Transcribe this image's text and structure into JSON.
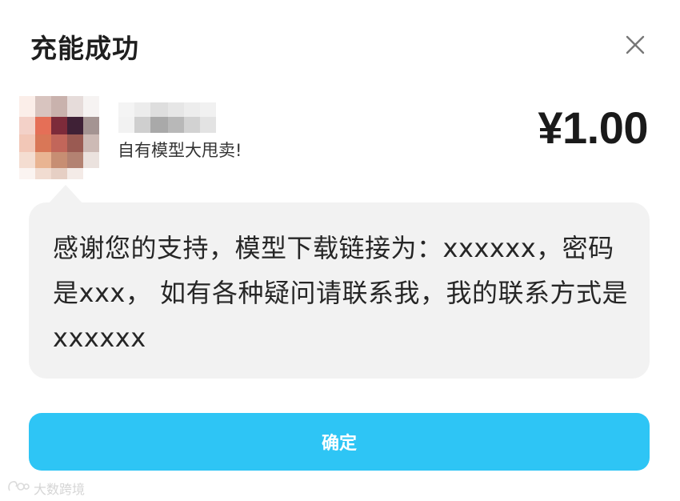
{
  "dialog": {
    "title": "充能成功",
    "close_icon": "close-icon",
    "subtitle": "自有模型大甩卖!",
    "price": "¥1.00",
    "message": "感谢您的支持，模型下载链接为：xxxxxx，密码是xxx， 如有各种疑问请联系我，我的联系方式是xxxxxx",
    "confirm_label": "确定"
  },
  "watermark": {
    "icon": "logo-icon",
    "text": "大数跨境"
  },
  "colors": {
    "primary_button": "#2ec5f5",
    "bubble_bg": "#f2f2f2"
  }
}
